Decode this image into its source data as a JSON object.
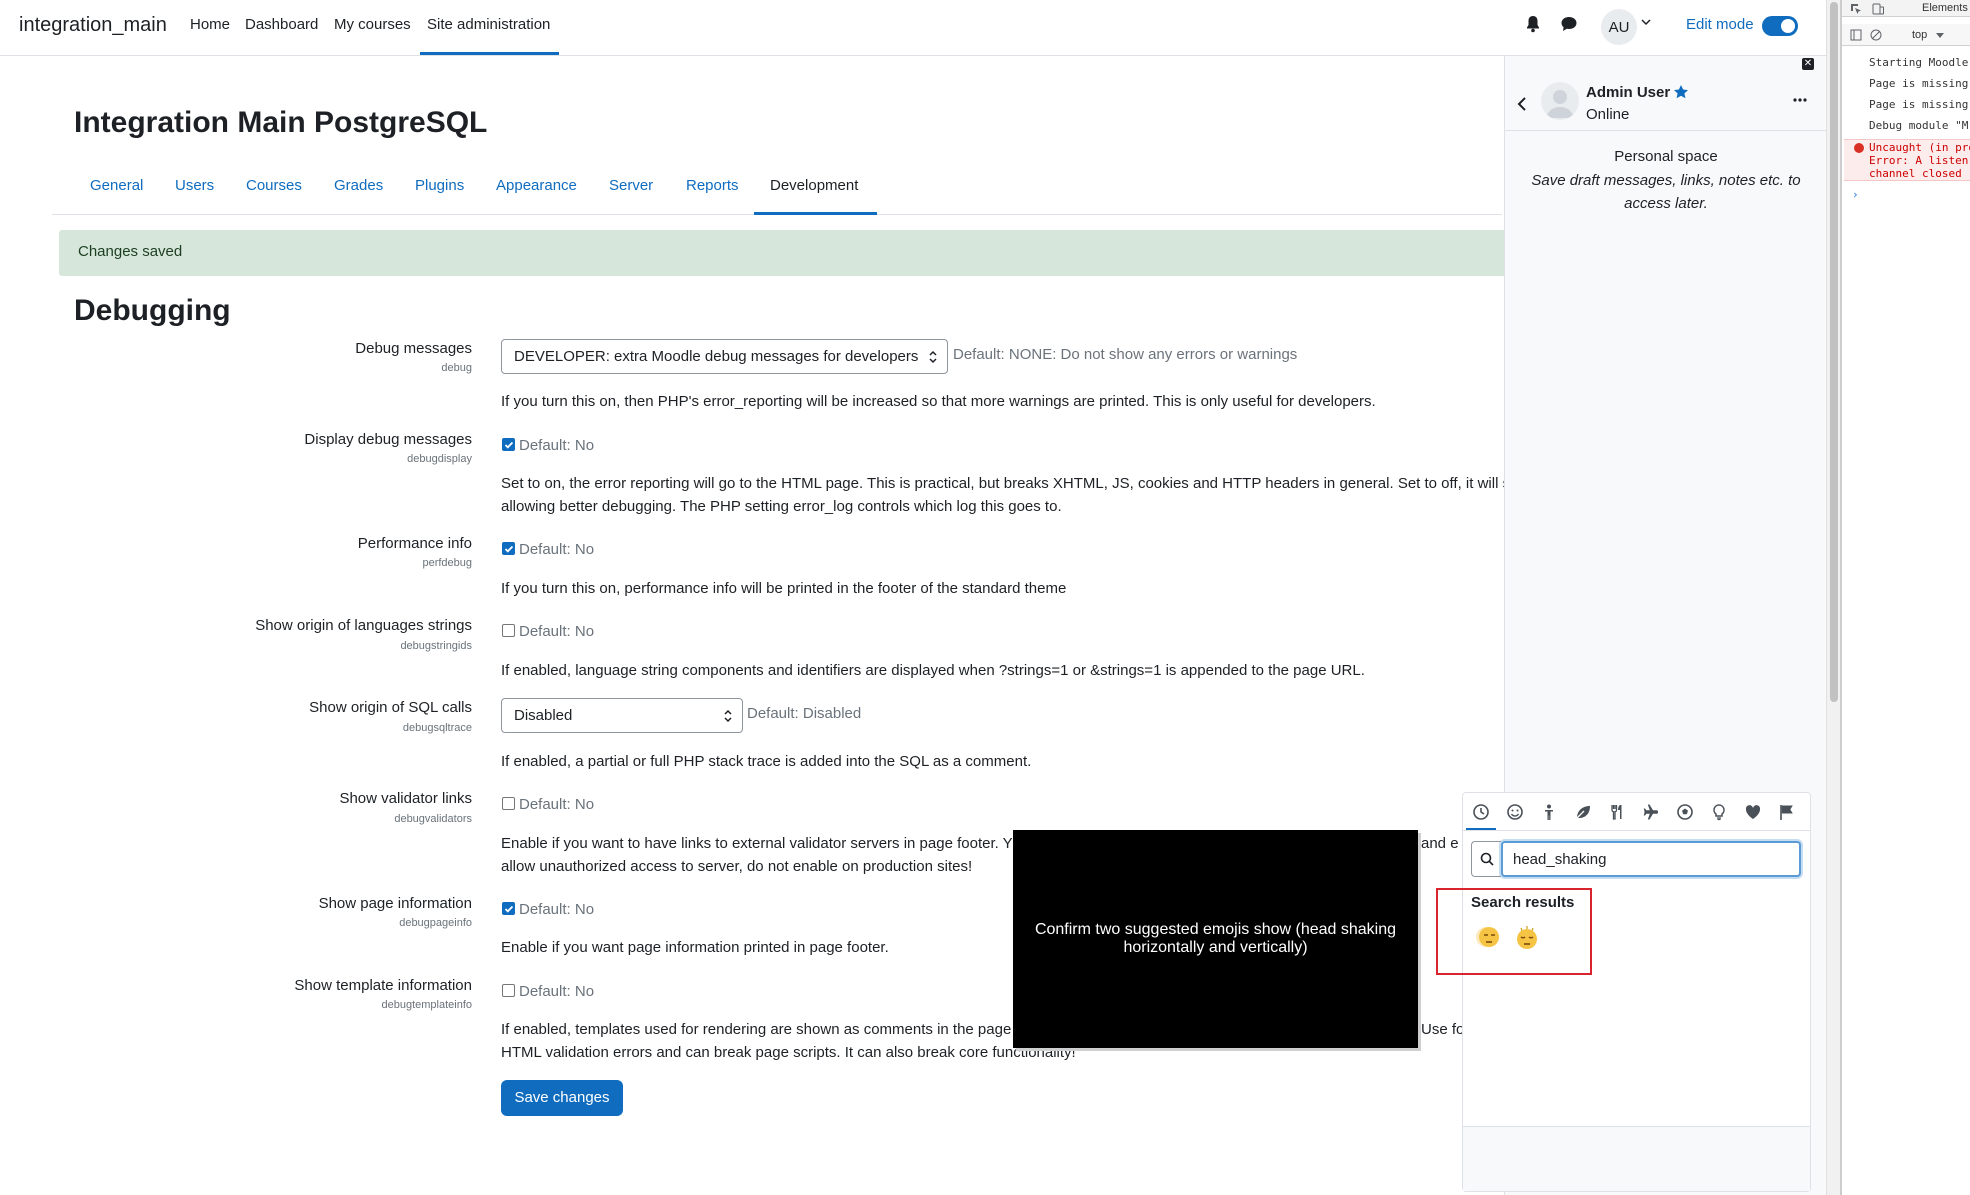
{
  "navbar": {
    "brand": "integration_main",
    "links": [
      "Home",
      "Dashboard",
      "My courses",
      "Site administration"
    ],
    "user_initials": "AU",
    "edit_mode_label": "Edit mode"
  },
  "page": {
    "title": "Integration Main PostgreSQL",
    "tabs": [
      "General",
      "Users",
      "Courses",
      "Grades",
      "Plugins",
      "Appearance",
      "Server",
      "Reports",
      "Development"
    ],
    "active_tab": "Development",
    "alert": "Changes saved",
    "section_title": "Debugging"
  },
  "settings": [
    {
      "label": "Debug messages",
      "key": "debug",
      "type": "select",
      "value": "DEVELOPER: extra Moodle debug messages for developers",
      "default": "Default: NONE: Do not show any errors or warnings",
      "description": [
        "If you turn this on, then PHP's error_reporting will be increased so that more warnings are printed. This is only useful for developers."
      ]
    },
    {
      "label": "Display debug messages",
      "key": "debugdisplay",
      "type": "checkbox",
      "checked": true,
      "default": "Default: No",
      "description": [
        "Set to on, the error reporting will go to the HTML page. This is practical, but breaks XHTML, JS, cookies and HTTP headers in general. Set to off, it will s",
        "allowing better debugging. The PHP setting error_log controls which log this goes to."
      ]
    },
    {
      "label": "Performance info",
      "key": "perfdebug",
      "type": "checkbox",
      "checked": true,
      "default": "Default: No",
      "description": [
        "If you turn this on, performance info will be printed in the footer of the standard theme"
      ]
    },
    {
      "label": "Show origin of languages strings",
      "key": "debugstringids",
      "type": "checkbox",
      "checked": false,
      "default": "Default: No",
      "description": [
        "If enabled, language string components and identifiers are displayed when ?strings=1 or &strings=1 is appended to the page URL."
      ]
    },
    {
      "label": "Show origin of SQL calls",
      "key": "debugsqltrace",
      "type": "select",
      "value": "Disabled",
      "default": "Default: Disabled",
      "description": [
        "If enabled, a partial or full PHP stack trace is added into the SQL as a comment."
      ]
    },
    {
      "label": "Show validator links",
      "key": "debugvalidators",
      "type": "checkbox",
      "checked": false,
      "default": "Default: No",
      "description": [
        "Enable if you want to have links to external validator servers in page footer. Y",
        "allow unauthorized access to server, do not enable on production sites!"
      ],
      "description_tail": "and e"
    },
    {
      "label": "Show page information",
      "key": "debugpageinfo",
      "type": "checkbox",
      "checked": true,
      "default": "Default: No",
      "description": [
        "Enable if you want page information printed in page footer."
      ]
    },
    {
      "label": "Show template information",
      "key": "debugtemplateinfo",
      "type": "checkbox",
      "checked": false,
      "default": "Default: No",
      "description": [
        "If enabled, templates used for rendering are shown as comments in the page",
        "HTML validation errors and can break page scripts. It can also break core functionality!"
      ],
      "description_tail": "Use fo"
    }
  ],
  "save_button": "Save changes",
  "overlay_text": "Confirm two suggested emojis show (head shaking horizontally and vertically)",
  "drawer": {
    "name": "Admin User",
    "status": "Online",
    "personal_space_title": "Personal space",
    "personal_space_desc": "Save draft messages, links, notes etc. to access later."
  },
  "emoji_picker": {
    "categories": [
      "recent-icon",
      "smiley-icon",
      "person-icon",
      "nature-icon",
      "food-icon",
      "travel-icon",
      "activity-icon",
      "objects-icon",
      "symbols-icon",
      "flags-icon"
    ],
    "search_value": "head_shaking",
    "results_title": "Search results",
    "results": [
      "head shaking horizontally",
      "head shaking vertically"
    ]
  },
  "devtools": {
    "tab": "Elements",
    "context": "top",
    "logs": [
      "Starting Moodle",
      "Page is missing",
      "Page is missing",
      "Debug module \"M"
    ],
    "error": [
      "Uncaught (in pro",
      "Error: A listen",
      "channel closed"
    ],
    "prompt": "›"
  },
  "colors": {
    "brand_blue": "#0f6cbf",
    "alert_bg": "#d7e6da",
    "highlight_red": "#d9232d",
    "overlay_bg": "#000000"
  }
}
